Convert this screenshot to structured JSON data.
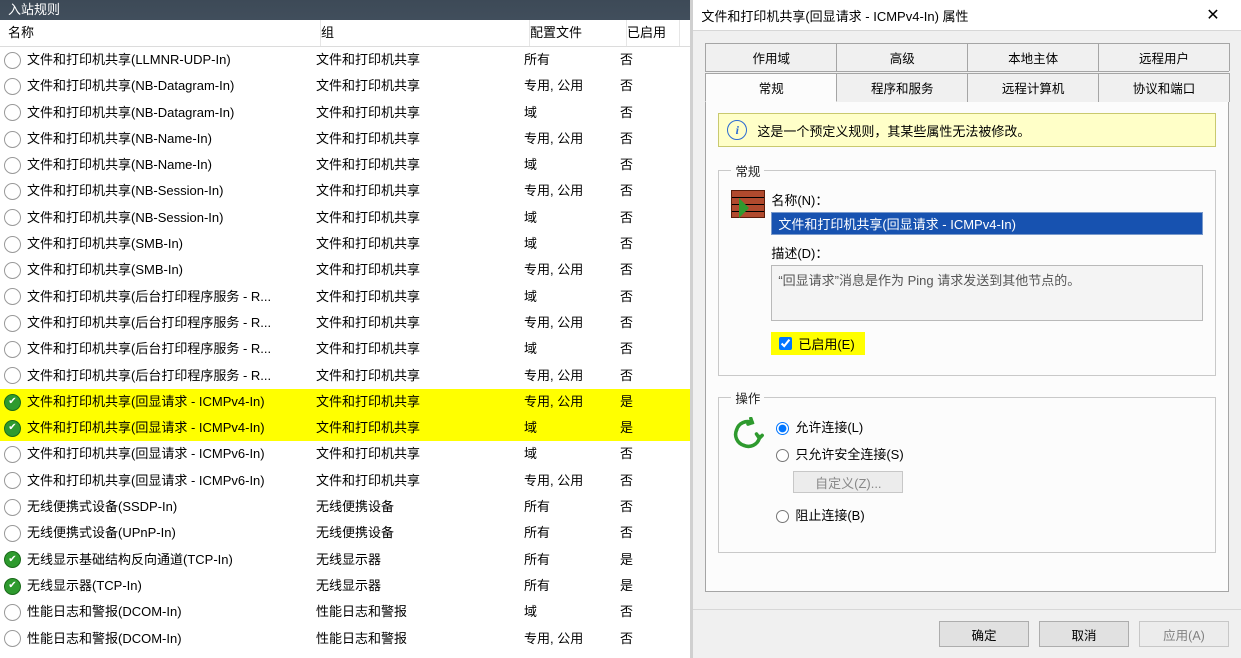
{
  "leftPane": {
    "title": "入站规则",
    "columns": {
      "name": "名称",
      "group": "组",
      "profile": "配置文件",
      "enabled": "已启用"
    }
  },
  "rules": [
    {
      "name": "文件和打印机共享(LLMNR-UDP-In)",
      "group": "文件和打印机共享",
      "profile": "所有",
      "enabled": "否",
      "on": false,
      "hl": false
    },
    {
      "name": "文件和打印机共享(NB-Datagram-In)",
      "group": "文件和打印机共享",
      "profile": "专用, 公用",
      "enabled": "否",
      "on": false,
      "hl": false
    },
    {
      "name": "文件和打印机共享(NB-Datagram-In)",
      "group": "文件和打印机共享",
      "profile": "域",
      "enabled": "否",
      "on": false,
      "hl": false
    },
    {
      "name": "文件和打印机共享(NB-Name-In)",
      "group": "文件和打印机共享",
      "profile": "专用, 公用",
      "enabled": "否",
      "on": false,
      "hl": false
    },
    {
      "name": "文件和打印机共享(NB-Name-In)",
      "group": "文件和打印机共享",
      "profile": "域",
      "enabled": "否",
      "on": false,
      "hl": false
    },
    {
      "name": "文件和打印机共享(NB-Session-In)",
      "group": "文件和打印机共享",
      "profile": "专用, 公用",
      "enabled": "否",
      "on": false,
      "hl": false
    },
    {
      "name": "文件和打印机共享(NB-Session-In)",
      "group": "文件和打印机共享",
      "profile": "域",
      "enabled": "否",
      "on": false,
      "hl": false
    },
    {
      "name": "文件和打印机共享(SMB-In)",
      "group": "文件和打印机共享",
      "profile": "域",
      "enabled": "否",
      "on": false,
      "hl": false
    },
    {
      "name": "文件和打印机共享(SMB-In)",
      "group": "文件和打印机共享",
      "profile": "专用, 公用",
      "enabled": "否",
      "on": false,
      "hl": false
    },
    {
      "name": "文件和打印机共享(后台打印程序服务 - R...",
      "group": "文件和打印机共享",
      "profile": "域",
      "enabled": "否",
      "on": false,
      "hl": false
    },
    {
      "name": "文件和打印机共享(后台打印程序服务 - R...",
      "group": "文件和打印机共享",
      "profile": "专用, 公用",
      "enabled": "否",
      "on": false,
      "hl": false
    },
    {
      "name": "文件和打印机共享(后台打印程序服务 - R...",
      "group": "文件和打印机共享",
      "profile": "域",
      "enabled": "否",
      "on": false,
      "hl": false
    },
    {
      "name": "文件和打印机共享(后台打印程序服务 - R...",
      "group": "文件和打印机共享",
      "profile": "专用, 公用",
      "enabled": "否",
      "on": false,
      "hl": false
    },
    {
      "name": "文件和打印机共享(回显请求 - ICMPv4-In)",
      "group": "文件和打印机共享",
      "profile": "专用, 公用",
      "enabled": "是",
      "on": true,
      "hl": true
    },
    {
      "name": "文件和打印机共享(回显请求 - ICMPv4-In)",
      "group": "文件和打印机共享",
      "profile": "域",
      "enabled": "是",
      "on": true,
      "hl": true
    },
    {
      "name": "文件和打印机共享(回显请求 - ICMPv6-In)",
      "group": "文件和打印机共享",
      "profile": "域",
      "enabled": "否",
      "on": false,
      "hl": false
    },
    {
      "name": "文件和打印机共享(回显请求 - ICMPv6-In)",
      "group": "文件和打印机共享",
      "profile": "专用, 公用",
      "enabled": "否",
      "on": false,
      "hl": false
    },
    {
      "name": "无线便携式设备(SSDP-In)",
      "group": "无线便携设备",
      "profile": "所有",
      "enabled": "否",
      "on": false,
      "hl": false
    },
    {
      "name": "无线便携式设备(UPnP-In)",
      "group": "无线便携设备",
      "profile": "所有",
      "enabled": "否",
      "on": false,
      "hl": false
    },
    {
      "name": "无线显示基础结构反向通道(TCP-In)",
      "group": "无线显示器",
      "profile": "所有",
      "enabled": "是",
      "on": true,
      "hl": false
    },
    {
      "name": "无线显示器(TCP-In)",
      "group": "无线显示器",
      "profile": "所有",
      "enabled": "是",
      "on": true,
      "hl": false
    },
    {
      "name": "性能日志和警报(DCOM-In)",
      "group": "性能日志和警报",
      "profile": "域",
      "enabled": "否",
      "on": false,
      "hl": false
    },
    {
      "name": "性能日志和警报(DCOM-In)",
      "group": "性能日志和警报",
      "profile": "专用, 公用",
      "enabled": "否",
      "on": false,
      "hl": false
    }
  ],
  "dialog": {
    "title": "文件和打印机共享(回显请求 - ICMPv4-In) 属性",
    "tabsTop": [
      "作用域",
      "高级",
      "本地主体",
      "远程用户"
    ],
    "tabsBot": [
      "常规",
      "程序和服务",
      "远程计算机",
      "协议和端口"
    ],
    "activeTab": "常规",
    "infoBar": "这是一个预定义规则，其某些属性无法被修改。",
    "groupGeneral": "常规",
    "nameLabel": "名称(N)：",
    "nameValue": "文件和打印机共享(回显请求 - ICMPv4-In)",
    "descLabel": "描述(D)：",
    "descValue": "“回显请求”消息是作为 Ping 请求发送到其他节点的。",
    "enableLabel": "已启用(E)",
    "groupAction": "操作",
    "radioAllow": "允许连接(L)",
    "radioSecure": "只允许安全连接(S)",
    "customizeBtn": "自定义(Z)...",
    "radioBlock": "阻止连接(B)",
    "buttons": {
      "ok": "确定",
      "cancel": "取消",
      "apply": "应用(A)"
    }
  }
}
